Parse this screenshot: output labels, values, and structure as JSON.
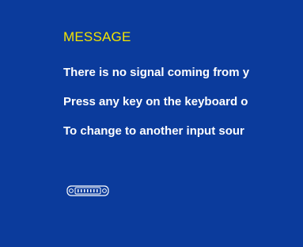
{
  "colors": {
    "background": "#0b3b9c",
    "title": "#f4e400",
    "text": "#ffffff"
  },
  "message": {
    "title": "MESSAGE",
    "lines": [
      "There is no signal coming from y",
      "Press any key on the keyboard o",
      "To change to another input sour"
    ]
  },
  "icons": {
    "connector": "dvi-connector-icon"
  }
}
